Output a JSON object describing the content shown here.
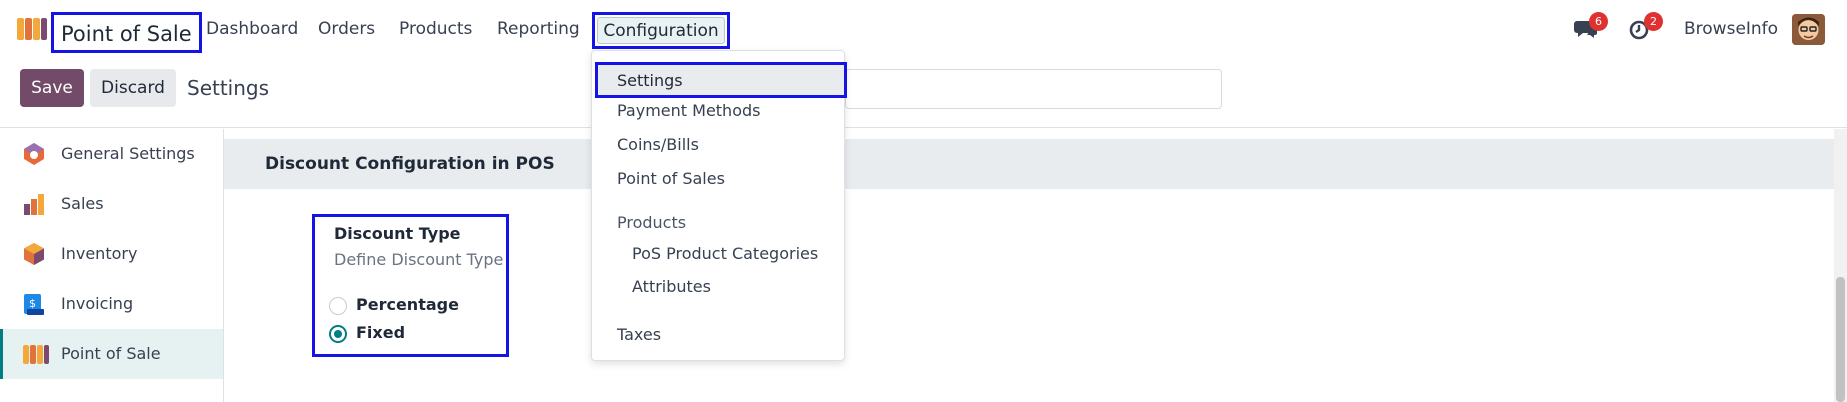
{
  "navbar": {
    "app_name": "Point of Sale",
    "menu": [
      "Dashboard",
      "Orders",
      "Products",
      "Reporting"
    ],
    "config_label": "Configuration",
    "messages_count": "6",
    "activities_count": "2",
    "user_name": "BrowseInfo"
  },
  "control_panel": {
    "save_label": "Save",
    "discard_label": "Discard",
    "title": "Settings"
  },
  "sidebar": {
    "items": [
      {
        "label": "General Settings",
        "icon": "general-settings-icon"
      },
      {
        "label": "Sales",
        "icon": "sales-icon"
      },
      {
        "label": "Inventory",
        "icon": "inventory-icon"
      },
      {
        "label": "Invoicing",
        "icon": "invoicing-icon"
      },
      {
        "label": "Point of Sale",
        "icon": "point-of-sale-icon",
        "active": true
      }
    ]
  },
  "main": {
    "section_title": "Discount Configuration in POS",
    "setting": {
      "title": "Discount Type",
      "description": "Define Discount Type",
      "options": [
        {
          "label": "Percentage",
          "checked": false
        },
        {
          "label": "Fixed",
          "checked": true
        }
      ]
    }
  },
  "dropdown": {
    "items": [
      "Settings",
      "Payment Methods",
      "Coins/Bills",
      "Point of Sales"
    ],
    "products_header": "Products",
    "product_items": [
      "PoS Product Categories",
      "Attributes"
    ],
    "taxes": "Taxes"
  },
  "colors": {
    "brand": "#714b67",
    "accent": "#017e84",
    "highlight_border": "#1414e6",
    "badge": "#e03131"
  }
}
